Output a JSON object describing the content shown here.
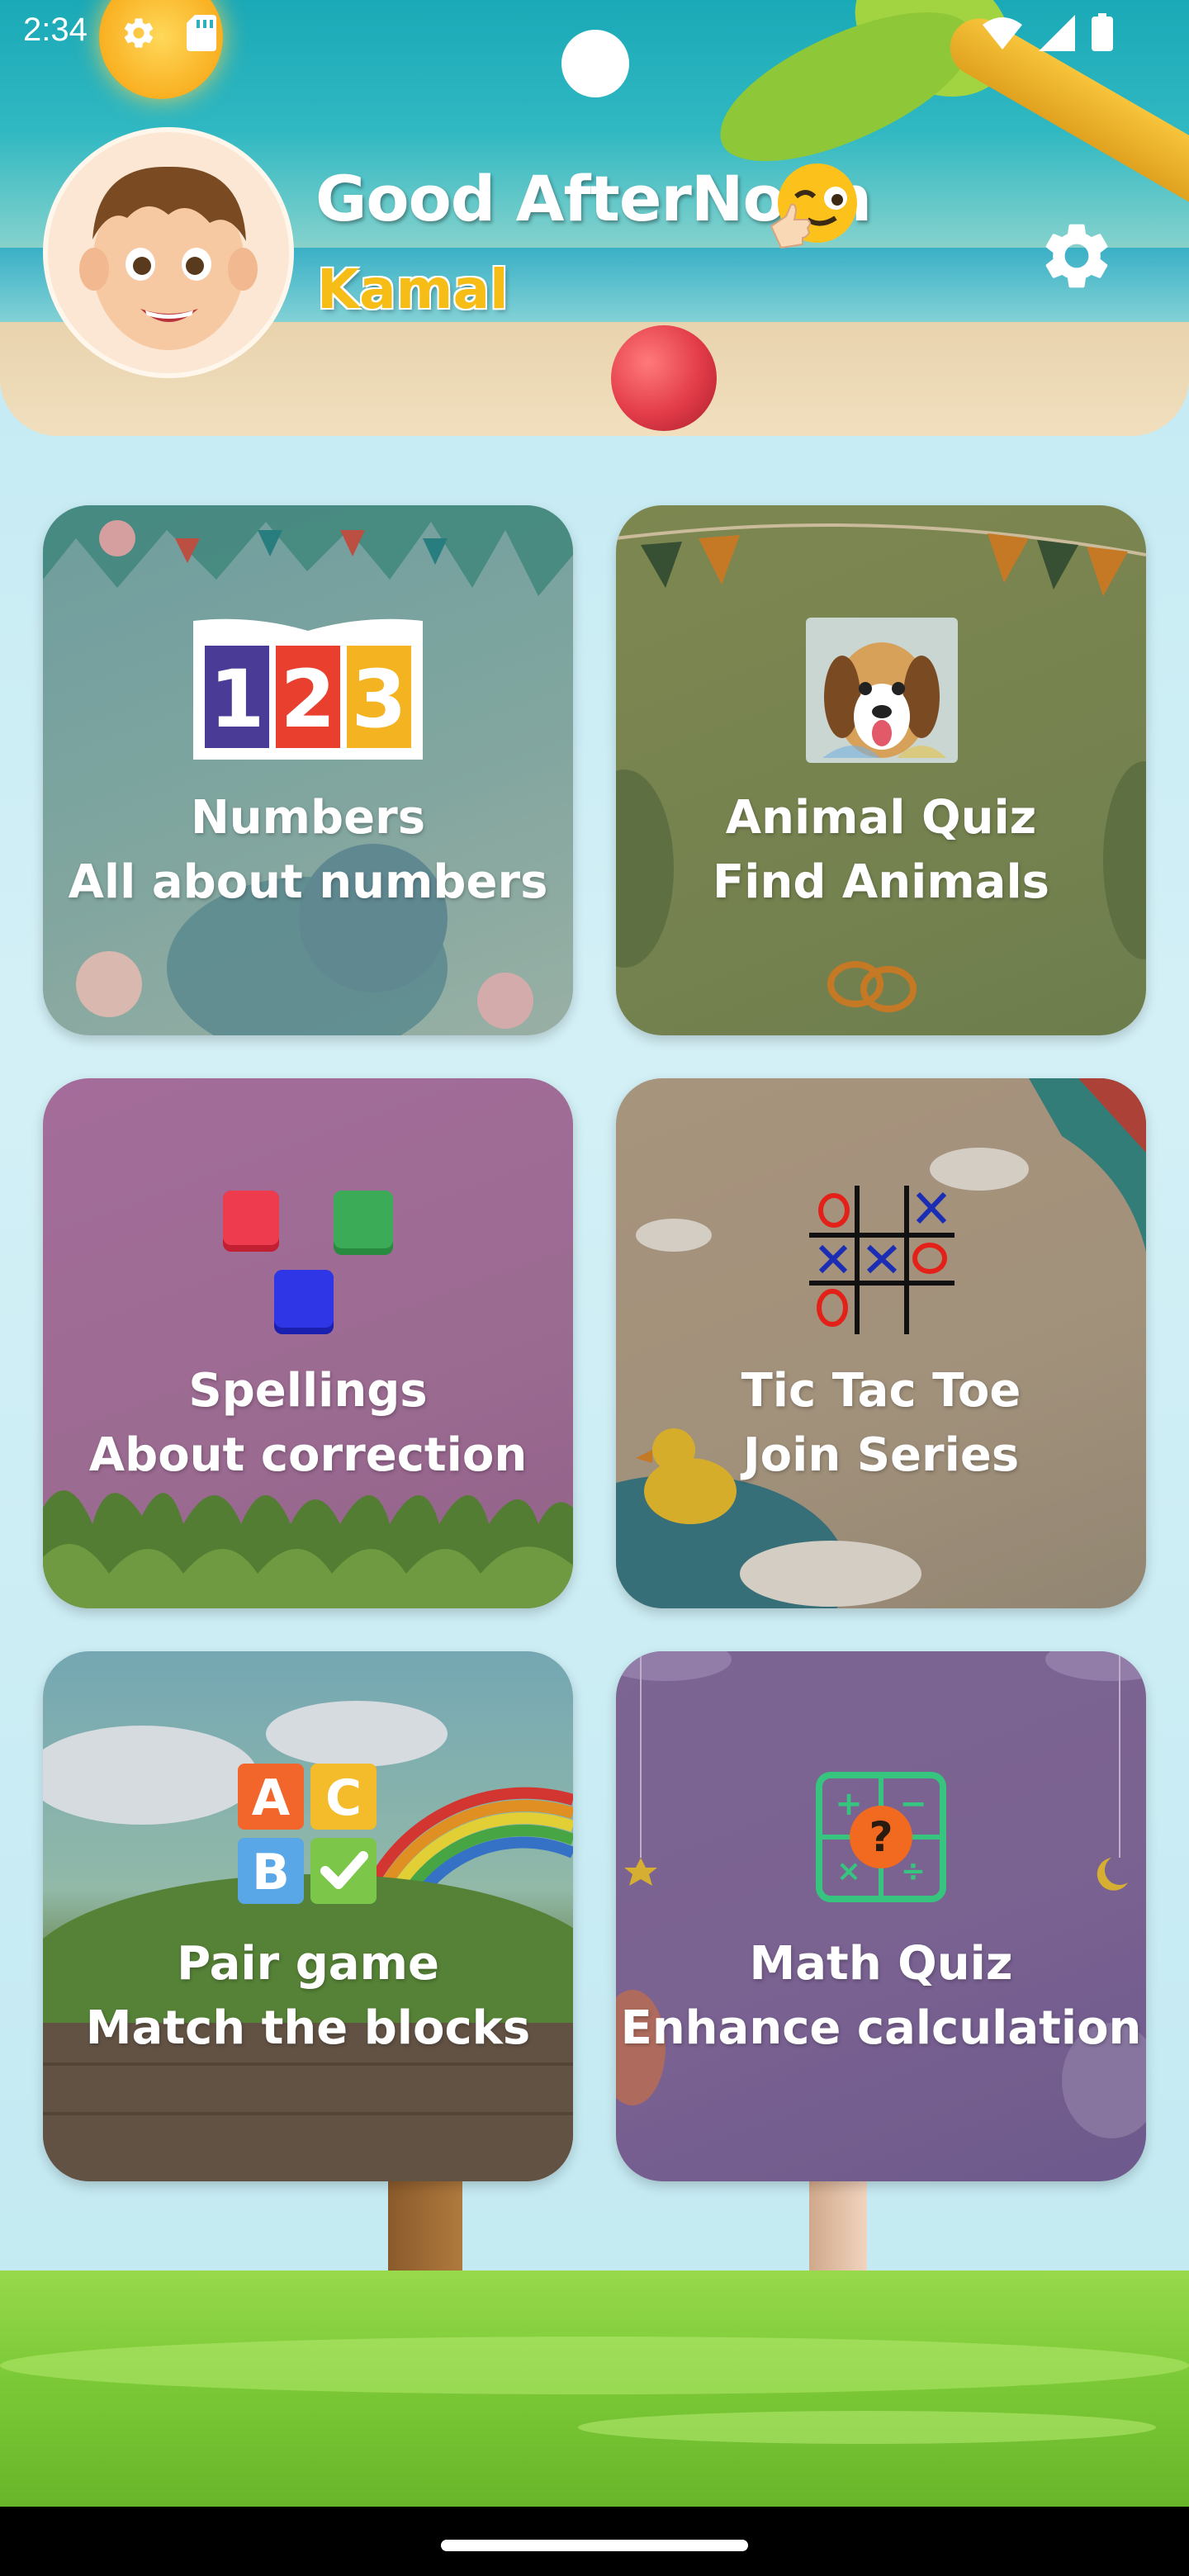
{
  "status_bar": {
    "time": "2:34",
    "icons": [
      "settings-icon",
      "sd-card-icon",
      "wifi-icon",
      "signal-icon",
      "battery-icon"
    ]
  },
  "header": {
    "greeting": "Good AfterNoon",
    "username": "Kamal",
    "emoji": "winking-thumbs-up-emoji",
    "settings_icon": "gear-icon"
  },
  "cards": [
    {
      "title": "Numbers",
      "subtitle": "All about numbers",
      "icon": "numbers-123-icon"
    },
    {
      "title": "Animal Quiz",
      "subtitle": "Find Animals",
      "icon": "dog-picture-icon"
    },
    {
      "title": "Spellings",
      "subtitle": "About correction",
      "icon": "colored-blocks-icon"
    },
    {
      "title": "Tic Tac Toe",
      "subtitle": "Join Series",
      "icon": "tic-tac-toe-icon"
    },
    {
      "title": "Pair game",
      "subtitle": "Match the blocks",
      "icon": "abc-blocks-icon"
    },
    {
      "title": "Math Quiz",
      "subtitle": "Enhance calculation",
      "icon": "math-calculator-icon"
    }
  ],
  "colors": {
    "header_teal": "#1aa9b7",
    "username_yellow": "#f6bd16",
    "grass_green": "#7cc937"
  }
}
